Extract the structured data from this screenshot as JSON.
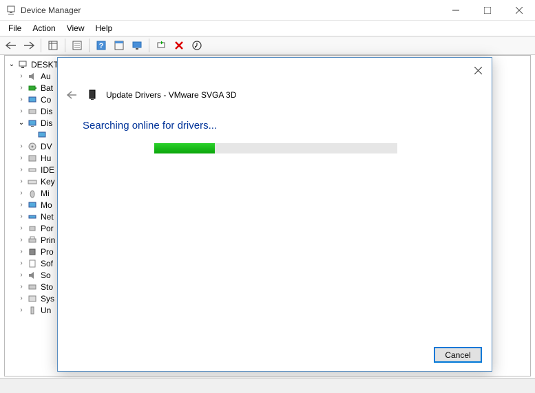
{
  "window": {
    "title": "Device Manager"
  },
  "menu": {
    "file": "File",
    "action": "Action",
    "view": "View",
    "help": "Help"
  },
  "tree": {
    "root": "DESKTO",
    "items": [
      {
        "label": "Au",
        "expanded": false
      },
      {
        "label": "Bat",
        "expanded": false
      },
      {
        "label": "Co",
        "expanded": false
      },
      {
        "label": "Dis",
        "expanded": false
      },
      {
        "label": "Dis",
        "expanded": true,
        "children": [
          {
            "label": ""
          }
        ]
      },
      {
        "label": "DV",
        "expanded": false
      },
      {
        "label": "Hu",
        "expanded": false
      },
      {
        "label": "IDE",
        "expanded": false
      },
      {
        "label": "Key",
        "expanded": false
      },
      {
        "label": "Mi",
        "expanded": false
      },
      {
        "label": "Mo",
        "expanded": false
      },
      {
        "label": "Net",
        "expanded": false
      },
      {
        "label": "Por",
        "expanded": false
      },
      {
        "label": "Prin",
        "expanded": false
      },
      {
        "label": "Pro",
        "expanded": false
      },
      {
        "label": "Sof",
        "expanded": false
      },
      {
        "label": "So",
        "expanded": false
      },
      {
        "label": "Sto",
        "expanded": false
      },
      {
        "label": "Sys",
        "expanded": false
      },
      {
        "label": "Un",
        "expanded": false
      }
    ]
  },
  "dialog": {
    "title": "Update Drivers - VMware SVGA 3D",
    "status": "Searching online for drivers...",
    "progress_percent": 25,
    "cancel": "Cancel"
  }
}
